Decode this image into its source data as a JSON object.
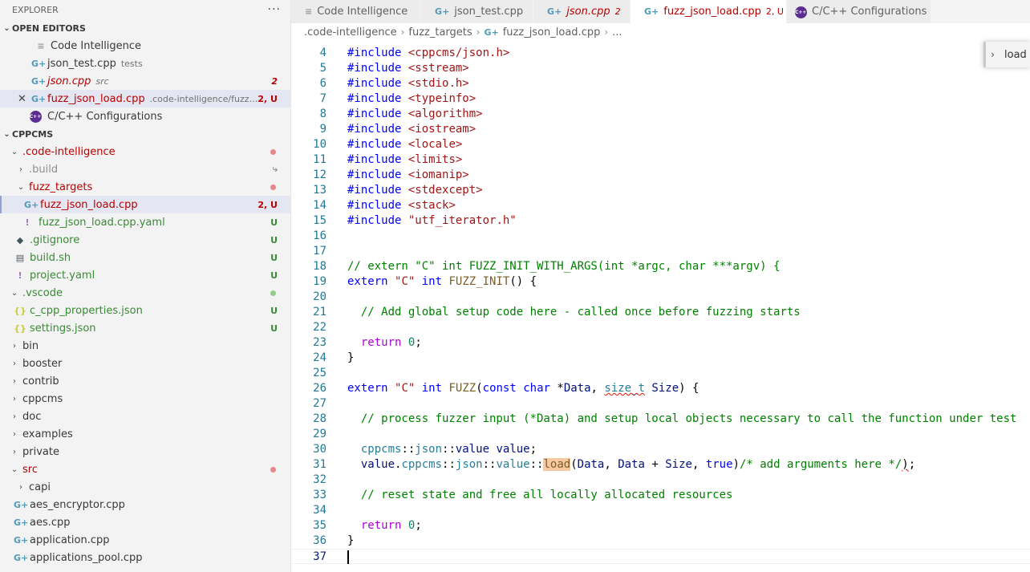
{
  "explorer": {
    "title": "EXPLORER",
    "more_label": "···",
    "open_editors": {
      "title": "OPEN EDITORS",
      "items": [
        {
          "icon": "text-file-icon",
          "label": "Code Intelligence",
          "desc": "",
          "badge": ""
        },
        {
          "icon": "cpp-file-icon",
          "label": "json_test.cpp",
          "desc": "tests",
          "badge": ""
        },
        {
          "icon": "cpp-file-icon",
          "label": "json.cpp",
          "desc": "src",
          "badge": "2"
        },
        {
          "icon": "cpp-file-icon",
          "label": "fuzz_json_load.cpp",
          "desc": ".code-intelligence/fuzz_t...",
          "badge": "2, U"
        },
        {
          "icon": "cpp-config-icon",
          "label": "C/C++ Configurations",
          "desc": "",
          "badge": ""
        }
      ]
    },
    "workspace": {
      "title": "CPPCMS",
      "items": [
        {
          "label": ".code-intelligence",
          "badge": ""
        },
        {
          "label": ".build",
          "badge": "⤷"
        },
        {
          "label": "fuzz_targets",
          "badge": ""
        },
        {
          "label": "fuzz_json_load.cpp",
          "badge": "2, U"
        },
        {
          "label": "fuzz_json_load.cpp.yaml",
          "badge": "U"
        },
        {
          "label": ".gitignore",
          "badge": "U"
        },
        {
          "label": "build.sh",
          "badge": "U"
        },
        {
          "label": "project.yaml",
          "badge": "U"
        },
        {
          "label": ".vscode",
          "badge": ""
        },
        {
          "label": "c_cpp_properties.json",
          "badge": "U"
        },
        {
          "label": "settings.json",
          "badge": "U"
        },
        {
          "label": "bin",
          "badge": ""
        },
        {
          "label": "booster",
          "badge": ""
        },
        {
          "label": "contrib",
          "badge": ""
        },
        {
          "label": "cppcms",
          "badge": ""
        },
        {
          "label": "doc",
          "badge": ""
        },
        {
          "label": "examples",
          "badge": ""
        },
        {
          "label": "private",
          "badge": ""
        },
        {
          "label": "src",
          "badge": ""
        },
        {
          "label": "capi",
          "badge": ""
        },
        {
          "label": "aes_encryptor.cpp",
          "badge": ""
        },
        {
          "label": "aes.cpp",
          "badge": ""
        },
        {
          "label": "application.cpp",
          "badge": ""
        },
        {
          "label": "applications_pool.cpp",
          "badge": ""
        }
      ]
    }
  },
  "tabs": [
    {
      "label": "Code Intelligence",
      "badge": "",
      "active": false
    },
    {
      "label": "json_test.cpp",
      "badge": "",
      "active": false
    },
    {
      "label": "json.cpp",
      "badge": "2",
      "active": false
    },
    {
      "label": "fuzz_json_load.cpp",
      "badge": "2, U",
      "active": true
    },
    {
      "label": "C/C++ Configurations",
      "badge": "",
      "active": false
    }
  ],
  "tab_close_glyph": "✕",
  "breadcrumb": [
    ".code-intelligence",
    "fuzz_targets",
    "fuzz_json_load.cpp",
    "..."
  ],
  "find_widget": {
    "value": "load"
  },
  "code_lines": [
    {
      "n": "4",
      "text": "#include <cppcms/json.h>"
    },
    {
      "n": "5",
      "text": "#include <sstream>"
    },
    {
      "n": "6",
      "text": "#include <stdio.h>"
    },
    {
      "n": "7",
      "text": "#include <typeinfo>"
    },
    {
      "n": "8",
      "text": "#include <algorithm>"
    },
    {
      "n": "9",
      "text": "#include <iostream>"
    },
    {
      "n": "10",
      "text": "#include <locale>"
    },
    {
      "n": "11",
      "text": "#include <limits>"
    },
    {
      "n": "12",
      "text": "#include <iomanip>"
    },
    {
      "n": "13",
      "text": "#include <stdexcept>"
    },
    {
      "n": "14",
      "text": "#include <stack>"
    },
    {
      "n": "15",
      "text": "#include \"utf_iterator.h\""
    },
    {
      "n": "16",
      "text": ""
    },
    {
      "n": "17",
      "text": ""
    },
    {
      "n": "18",
      "text": "// extern \"C\" int FUZZ_INIT_WITH_ARGS(int *argc, char ***argv) {"
    },
    {
      "n": "19",
      "text": "extern \"C\" int FUZZ_INIT() {"
    },
    {
      "n": "20",
      "text": ""
    },
    {
      "n": "21",
      "text": "  // Add global setup code here - called once before fuzzing starts"
    },
    {
      "n": "22",
      "text": ""
    },
    {
      "n": "23",
      "text": "  return 0;"
    },
    {
      "n": "24",
      "text": "}"
    },
    {
      "n": "25",
      "text": ""
    },
    {
      "n": "26",
      "text": "extern \"C\" int FUZZ(const char *Data, size_t Size) {"
    },
    {
      "n": "27",
      "text": ""
    },
    {
      "n": "28",
      "text": "  // process fuzzer input (*Data) and setup local objects necessary to call the function under test"
    },
    {
      "n": "29",
      "text": ""
    },
    {
      "n": "30",
      "text": "  cppcms::json::value value;"
    },
    {
      "n": "31",
      "text": "  value.cppcms::json::value::load(Data, Data + Size, true)/* add arguments here */);"
    },
    {
      "n": "32",
      "text": ""
    },
    {
      "n": "33",
      "text": "  // reset state and free all locally allocated resources"
    },
    {
      "n": "34",
      "text": ""
    },
    {
      "n": "35",
      "text": "  return 0;"
    },
    {
      "n": "36",
      "text": "}"
    },
    {
      "n": "37",
      "text": ""
    }
  ]
}
